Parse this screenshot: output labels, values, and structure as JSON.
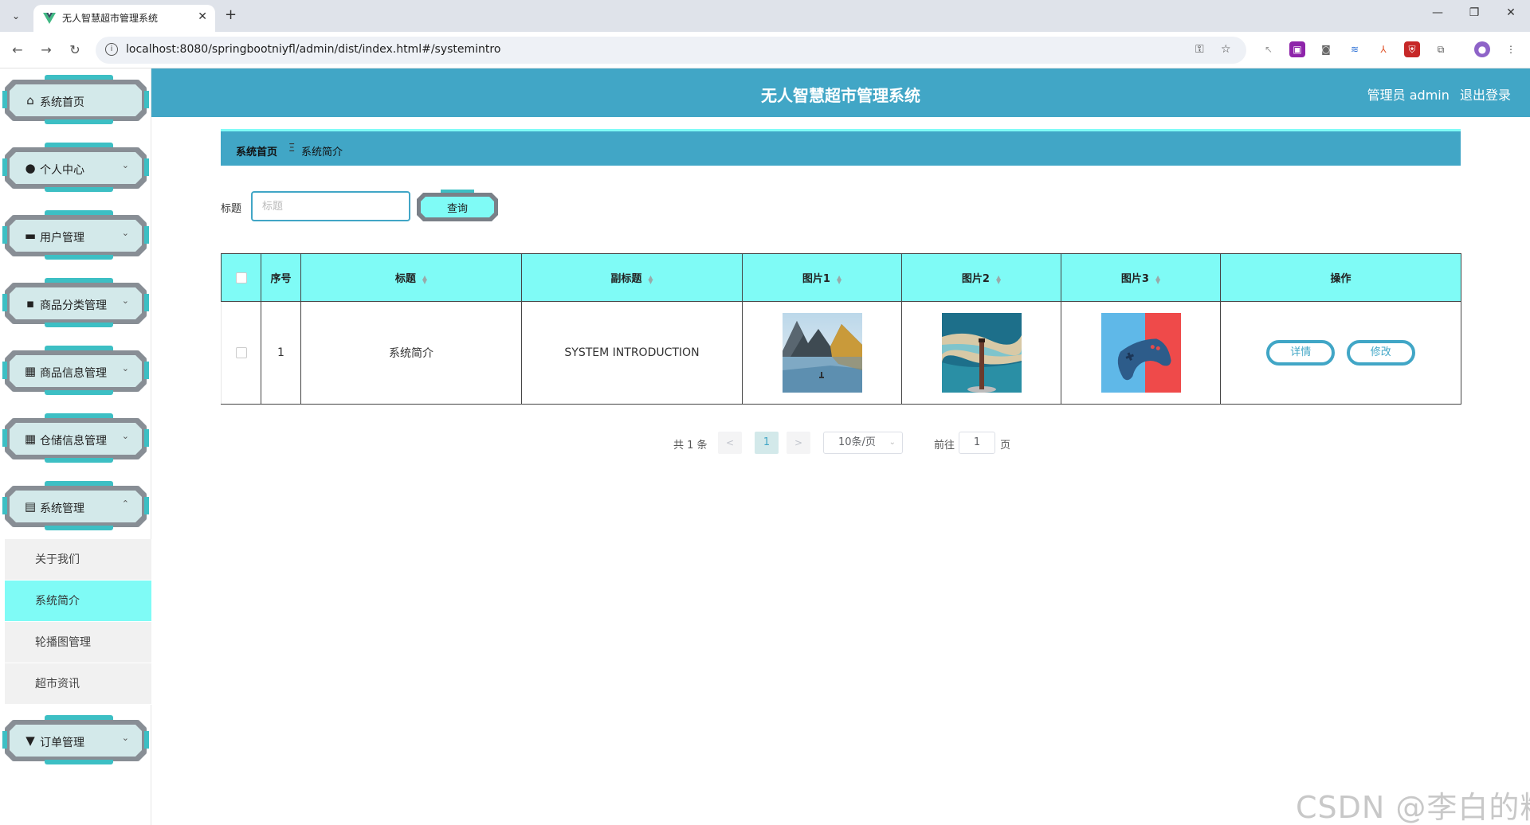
{
  "browser": {
    "tab_title": "无人智慧超市管理系统",
    "url": "localhost:8080/springbootniyfl/admin/dist/index.html#/systemintro"
  },
  "header": {
    "title": "无人智慧超市管理系统",
    "user": "管理员 admin",
    "logout": "退出登录"
  },
  "sidebar": {
    "items": [
      {
        "label": "系统首页",
        "icon": "home-icon",
        "has_chevron": false
      },
      {
        "label": "个人中心",
        "icon": "user-icon",
        "has_chevron": true
      },
      {
        "label": "用户管理",
        "icon": "briefcase-icon",
        "has_chevron": true
      },
      {
        "label": "商品分类管理",
        "icon": "chat-icon",
        "has_chevron": true
      },
      {
        "label": "商品信息管理",
        "icon": "grid-icon",
        "has_chevron": true
      },
      {
        "label": "仓储信息管理",
        "icon": "grid-icon",
        "has_chevron": true
      },
      {
        "label": "系统管理",
        "icon": "clipboard-icon",
        "has_chevron": true
      },
      {
        "label": "订单管理",
        "icon": "pushpin-icon",
        "has_chevron": true
      }
    ],
    "submenu": [
      {
        "label": "关于我们",
        "active": false
      },
      {
        "label": "系统简介",
        "active": true
      },
      {
        "label": "轮播图管理",
        "active": false
      },
      {
        "label": "超市资讯",
        "active": false
      }
    ]
  },
  "breadcrumb": {
    "home": "系统首页",
    "separator": "Ξ",
    "current": "系统简介"
  },
  "search": {
    "label": "标题",
    "placeholder": "标题",
    "button": "查询"
  },
  "table": {
    "headers": [
      "序号",
      "标题",
      "副标题",
      "图片1",
      "图片2",
      "图片3",
      "操作"
    ],
    "rows": [
      {
        "index": "1",
        "title": "系统简介",
        "subtitle": "SYSTEM INTRODUCTION",
        "image1": "mountain-lake-image",
        "image2": "lighthouse-beach-image",
        "image3": "gamepad-image"
      }
    ],
    "actions": {
      "detail": "详情",
      "edit": "修改"
    }
  },
  "pagination": {
    "total": "共 1 条",
    "prev": "<",
    "current_page": "1",
    "next": ">",
    "page_size": "10条/页",
    "goto_label": "前往",
    "goto_value": "1",
    "page_suffix": "页"
  },
  "watermark": "CSDN @李白的粉",
  "colors": {
    "header": "#41a6c6",
    "accent": "#7ffbf6",
    "menu_fill": "#d3e9ea"
  }
}
